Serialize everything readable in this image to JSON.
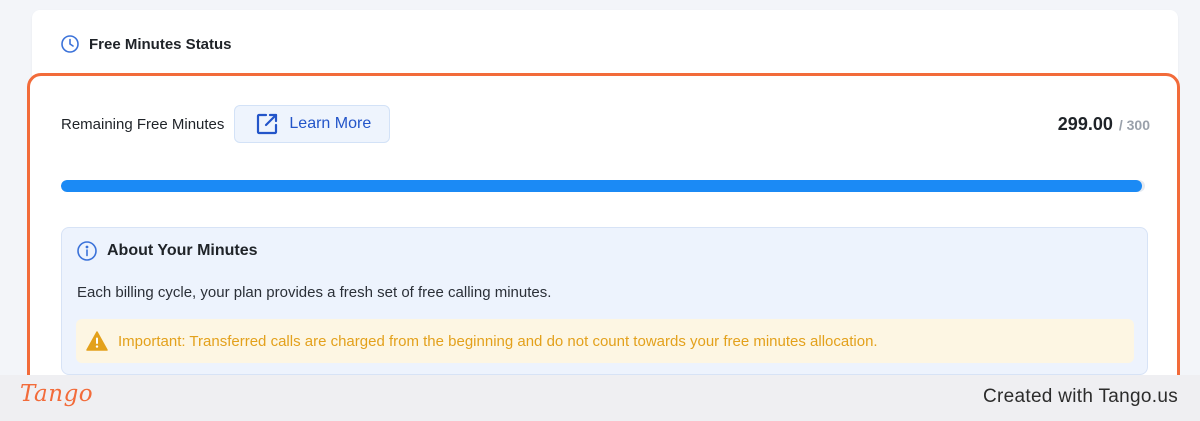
{
  "card": {
    "title": "Free Minutes Status",
    "title_icon": "clock-icon"
  },
  "usage": {
    "label": "Remaining Free Minutes",
    "learn_more_label": "Learn More",
    "learn_more_icon": "external-link-icon",
    "remaining": "299.00",
    "total_display": "/ 300",
    "progress_fraction": 0.997
  },
  "about": {
    "title": "About Your Minutes",
    "title_icon": "info-icon",
    "description": "Each billing cycle, your plan provides a fresh set of free calling minutes.",
    "warning_icon": "warning-icon",
    "warning_text": "Important: Transferred calls are charged from the beginning and do not count towards your free minutes allocation."
  },
  "footer": {
    "logo_text": "Tango",
    "credit": "Created with Tango.us"
  },
  "colors": {
    "accent": "#1b8af5",
    "highlight_border": "#f26b3a",
    "warning": "#e3a11c",
    "link": "#2355c9"
  }
}
